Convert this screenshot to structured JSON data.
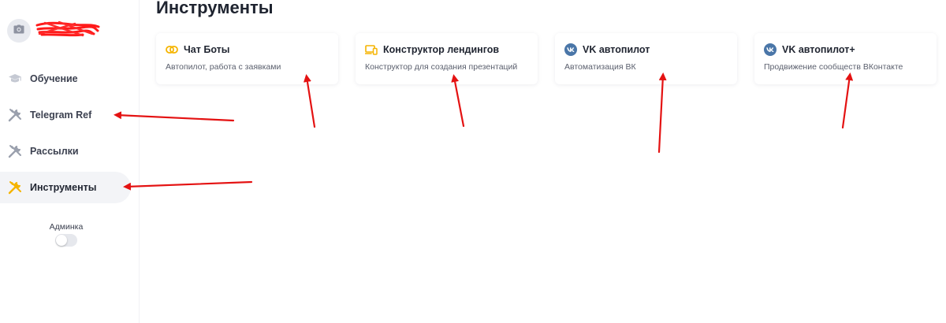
{
  "page": {
    "title": "Инструменты"
  },
  "sidebar": {
    "items": [
      {
        "label": "Обучение",
        "icon": "graduation-cap-icon"
      },
      {
        "label": "Telegram Ref",
        "icon": "tools-icon"
      },
      {
        "label": "Рассылки",
        "icon": "tools-icon"
      },
      {
        "label": "Инструменты",
        "icon": "tools-icon",
        "active": true
      }
    ],
    "admin": {
      "label": "Админка",
      "enabled": false
    }
  },
  "cards": [
    {
      "title": "Чат Боты",
      "description": "Автопилот, работа с заявками",
      "icon": "link-icon"
    },
    {
      "title": "Конструктор лендингов",
      "description": "Конструктор для создания презентаций",
      "icon": "devices-icon"
    },
    {
      "title": "VK автопилот",
      "description": "Автоматизация ВК",
      "icon": "vk-icon"
    },
    {
      "title": "VK автопилот+",
      "description": "Продвижение сообществ ВКонтакте",
      "icon": "vk-icon"
    }
  ],
  "colors": {
    "accent_yellow": "#f5b400",
    "vk_blue": "#4a76a8",
    "annotation_red": "#e41212",
    "active_bg": "#f3f4f7"
  }
}
